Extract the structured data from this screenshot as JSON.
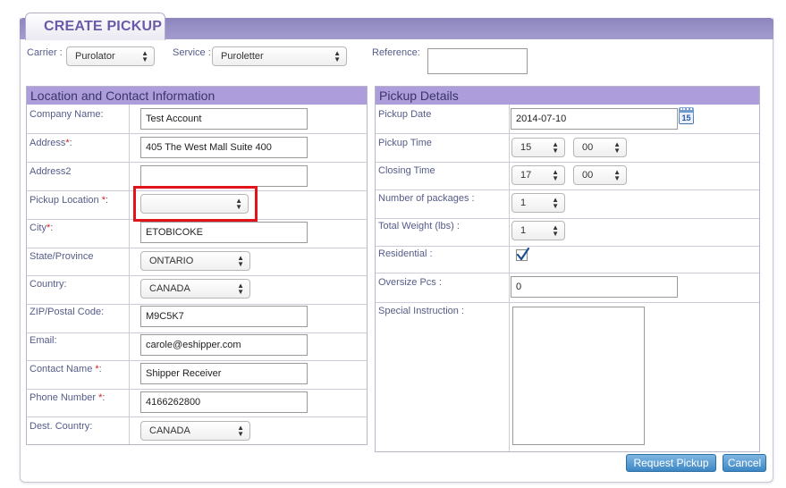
{
  "tab": {
    "title": "CREATE PICKUP"
  },
  "top": {
    "carrier": {
      "label": "Carrier :",
      "value": "Purolator"
    },
    "service": {
      "label": "Service :",
      "value": "Puroletter"
    },
    "reference": {
      "label": "Reference:",
      "value": ""
    }
  },
  "location": {
    "heading": "Location and Contact Information",
    "company_name": {
      "label": "Company Name:",
      "value": "Test Account"
    },
    "address": {
      "label": "Address",
      "required": "*",
      "suffix": ":",
      "value": "405 The West Mall Suite 400"
    },
    "address2": {
      "label": "Address2",
      "value": ""
    },
    "pickup_location": {
      "label": "Pickup Location",
      "required": "*",
      "suffix": ":",
      "value": ""
    },
    "city": {
      "label": "City",
      "required": "*",
      "suffix": ":",
      "value": "ETOBICOKE"
    },
    "state": {
      "label": "State/Province",
      "value": "ONTARIO"
    },
    "country": {
      "label": "Country:",
      "value": "CANADA"
    },
    "zip": {
      "label": "ZIP/Postal Code:",
      "value": "M9C5K7"
    },
    "email": {
      "label": "Email:",
      "value": "carole@eshipper.com"
    },
    "contact_name": {
      "label": "Contact Name",
      "required": "*",
      "suffix": ":",
      "value": "Shipper Receiver"
    },
    "phone": {
      "label": "Phone Number",
      "required": "*",
      "suffix": ":",
      "value": "4166262800"
    },
    "dest_country": {
      "label": "Dest. Country:",
      "value": "CANADA"
    }
  },
  "pickup": {
    "heading": "Pickup Details",
    "date": {
      "label": "Pickup Date",
      "value": "2014-07-10",
      "calendar_day": "15"
    },
    "time": {
      "label": "Pickup Time",
      "hour": "15",
      "minute": "00"
    },
    "closing": {
      "label": "Closing Time",
      "hour": "17",
      "minute": "00"
    },
    "packages": {
      "label": "Number of packages :",
      "value": "1"
    },
    "weight": {
      "label": "Total Weight (lbs) :",
      "value": "1"
    },
    "residential": {
      "label": "Residential :",
      "checked": true
    },
    "oversize": {
      "label": "Oversize Pcs :",
      "value": "0"
    },
    "instruction": {
      "label": "Special Instruction :",
      "value": ""
    }
  },
  "buttons": {
    "request": "Request Pickup",
    "cancel": "Cancel"
  },
  "colors": {
    "accent": "#ad9edb",
    "header_band": "#8d86be",
    "highlight": "#e0141a",
    "button": "#3d87c4"
  }
}
